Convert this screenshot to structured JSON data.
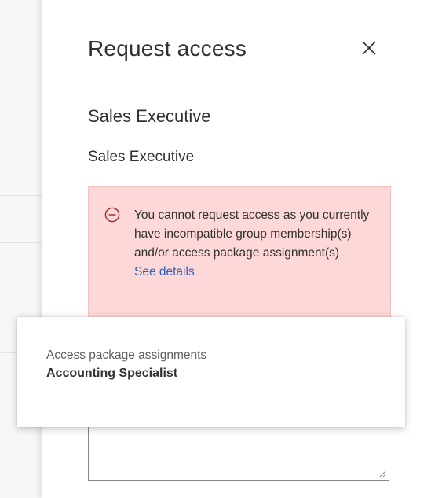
{
  "panel": {
    "title": "Request access",
    "close_icon": "close-icon",
    "package_name": "Sales Executive",
    "role_name": "Sales Executive"
  },
  "error": {
    "icon": "error-circle-minus-icon",
    "message": "You cannot request access as you currently have incompatible group membership(s) and/or access package assignment(s)",
    "link_label": "See details",
    "background": "#fdd8d8",
    "link_color": "#2b61c4"
  },
  "popup": {
    "label": "Access package assignments",
    "value": "Accounting Specialist"
  }
}
